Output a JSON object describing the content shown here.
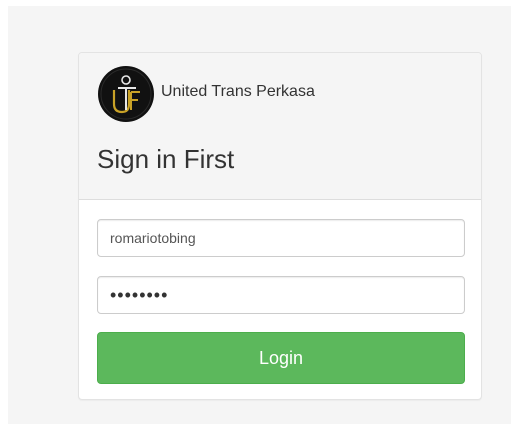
{
  "header": {
    "company_name": "United Trans Perkasa",
    "title": "Sign in First"
  },
  "logo": {
    "icon": "utf-monogram-logo",
    "letters": "UTF"
  },
  "form": {
    "username_value": "romariotobing",
    "password_value": "password",
    "login_label": "Login"
  },
  "colors": {
    "primary": "#5cb85c",
    "logo_bg": "#111111",
    "logo_gold": "#c9a227"
  }
}
